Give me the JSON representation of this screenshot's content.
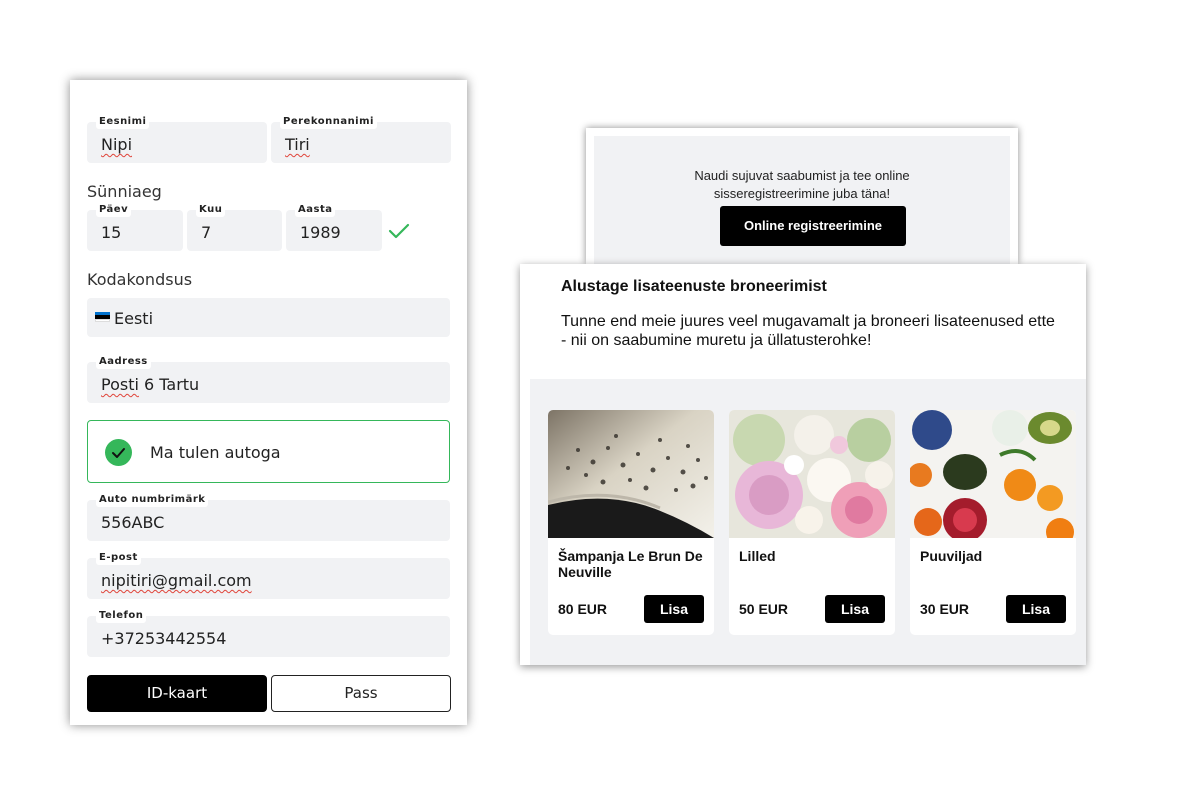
{
  "form": {
    "first_name": {
      "label": "Eesnimi",
      "value": "Nipi"
    },
    "last_name": {
      "label": "Perekonnanimi",
      "value": "Tiri"
    },
    "birthdate": {
      "title": "Sünniaeg",
      "day": {
        "label": "Päev",
        "value": "15"
      },
      "month": {
        "label": "Kuu",
        "value": "7"
      },
      "year": {
        "label": "Aasta",
        "value": "1989"
      },
      "valid_icon": "check-icon",
      "valid_color": "#35b75a"
    },
    "citizenship": {
      "title": "Kodakondsus",
      "value": "Eesti",
      "flag": [
        "#0072ce",
        "#000000",
        "#ffffff"
      ]
    },
    "address": {
      "label": "Aadress",
      "value": "Posti 6 Tartu"
    },
    "car": {
      "label": "Ma tulen autoga",
      "checked": true
    },
    "license_plate": {
      "label": "Auto numbrimärk",
      "value": "556ABC"
    },
    "email": {
      "label": "E-post",
      "value": "nipitiri@gmail.com"
    },
    "phone": {
      "label": "Telefon",
      "value": "+37253442554"
    },
    "document_types": [
      {
        "label": "ID-kaart",
        "selected": true
      },
      {
        "label": "Pass",
        "selected": false
      }
    ]
  },
  "registration": {
    "text_line1": "Naudi sujuvat saabumist ja tee online",
    "text_line2": "sisseregistreerimine juba täna!",
    "button": "Online registreerimine"
  },
  "services": {
    "title": "Alustage lisateenuste broneerimist",
    "description": "Tunne end meie juures veel mugavamalt ja broneeri lisateenused ette - nii on saabumine muretu ja üllatusterohke!",
    "products": [
      {
        "name": "Šampanja Le Brun De Neuville",
        "price": "80 EUR",
        "button": "Lisa",
        "image": "champagne-image"
      },
      {
        "name": "Lilled",
        "price": "50 EUR",
        "button": "Lisa",
        "image": "flowers-image"
      },
      {
        "name": "Puuviljad",
        "price": "30 EUR",
        "button": "Lisa",
        "image": "fruits-image"
      }
    ]
  },
  "colors": {
    "accent_green": "#35b75a",
    "field_bg": "#f1f2f4",
    "button_black": "#000000"
  }
}
